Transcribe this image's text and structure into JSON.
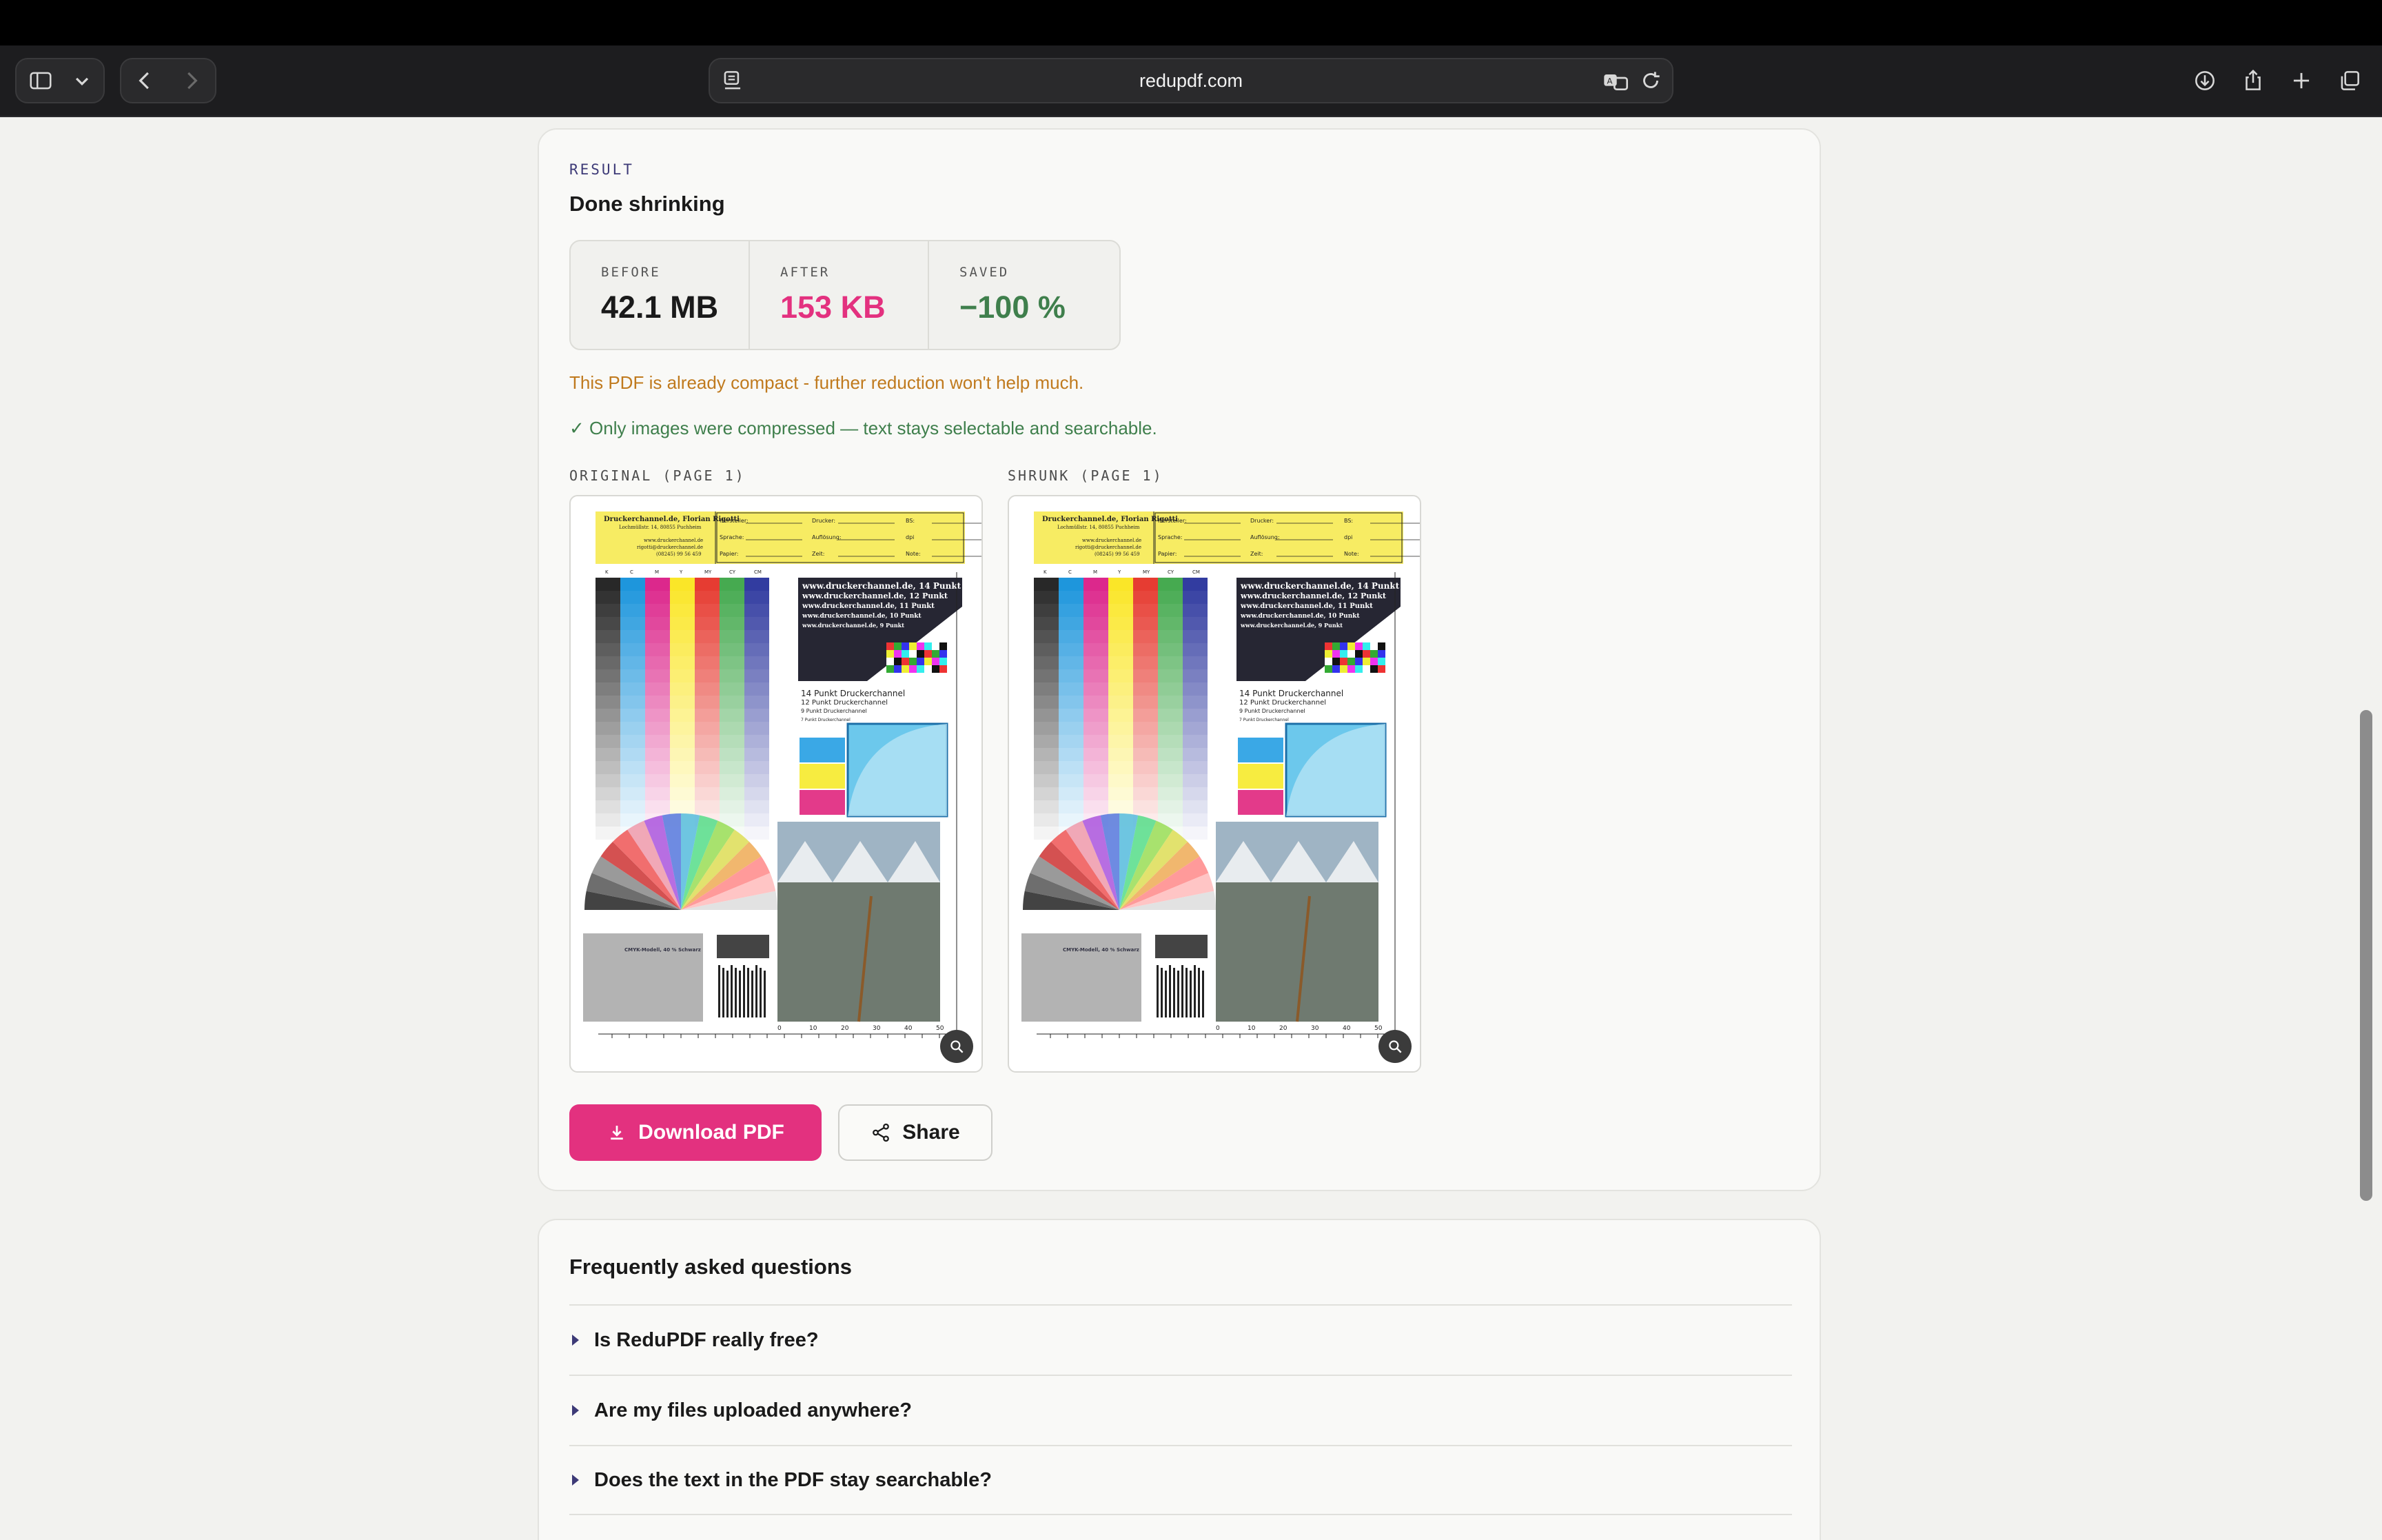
{
  "browser": {
    "url": "redupdf.com",
    "icons": [
      "sidebar-icon",
      "chevron-down-icon",
      "back-icon",
      "forward-icon",
      "reader-icon",
      "translate-icon",
      "reload-icon",
      "download-icon",
      "share-icon",
      "new-tab-icon",
      "tabs-overview-icon"
    ]
  },
  "result": {
    "label": "RESULT",
    "title": "Done shrinking",
    "stats": [
      {
        "key": "BEFORE",
        "value": "42.1 MB",
        "color": "#1a1a1a"
      },
      {
        "key": "AFTER",
        "value": "153 KB",
        "color": "#e3317f"
      },
      {
        "key": "SAVED",
        "value": "−100 %",
        "color": "#3f7f4c"
      }
    ],
    "warning": "This PDF is already compact - further reduction won't help much.",
    "ok_note": "✓ Only images were compressed — text stays selectable and searchable.",
    "previews": [
      {
        "label": "ORIGINAL (PAGE 1)"
      },
      {
        "label": "SHRUNK (PAGE 1)"
      }
    ],
    "download_label": "Download PDF",
    "share_label": "Share"
  },
  "page_content": {
    "brand": "Druckerchannel.de, Florian Rigotti",
    "address": "Lochmüllstr. 14, 80855 Puchheim",
    "web": "www.druckerchannel.de",
    "mail": "rigotti@druckerchannel.de",
    "phone": "(08245) 99 56 459",
    "fields": [
      "Hersteller:",
      "Drucker:",
      "BS:",
      "Sprache:",
      "Auflösung:",
      "dpi",
      "Papier:",
      "Zeit:",
      "Note:"
    ],
    "channels": [
      "K",
      "C",
      "M",
      "Y",
      "MY",
      "CY",
      "CM"
    ],
    "text_sample": [
      "www.druckerchannel.de, 14 Punkt",
      "www.druckerchannel.de, 12 Punkt",
      "www.druckerchannel.de, 11 Punkt",
      "www.druckerchannel.de, 10 Punkt",
      "www.druckerchannel.de, 9 Punkt"
    ],
    "sizes": [
      "14 Punkt  Druckerchannel",
      "12 Punkt  Druckerchannel",
      "9 Punkt  Druckerchannel",
      "7 Punkt  Druckerchannel"
    ],
    "cmyk_note": "CMYK-Modell, 40 % Schwarz",
    "ruler": [
      "0",
      "10",
      "20",
      "30",
      "40",
      "50"
    ]
  },
  "colors": {
    "accent": "#e3317f",
    "saved": "#3f7f4c",
    "warn": "#c07a1e",
    "label": "#3d3a77"
  },
  "faq": {
    "title": "Frequently asked questions",
    "items": [
      {
        "q": "Is ReduPDF really free?"
      },
      {
        "q": "Are my files uploaded anywhere?"
      },
      {
        "q": "Does the text in the PDF stay searchable?"
      }
    ]
  }
}
